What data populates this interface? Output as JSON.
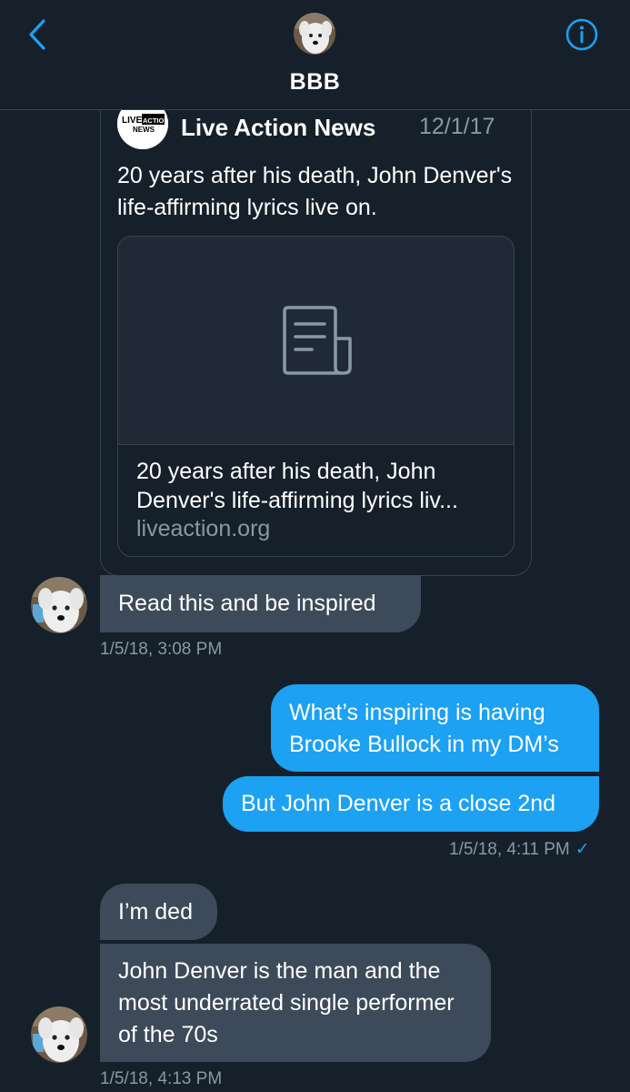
{
  "header": {
    "title": "BBB"
  },
  "shared_tweet": {
    "logo_text_top": "LIVE",
    "logo_text_mid": "ACTION",
    "logo_text_bottom": "NEWS",
    "author": "Live Action News",
    "date": "12/1/17",
    "text": "20 years after his death, John Denver's life-affirming lyrics live on.",
    "link_card": {
      "title": "20 years after his death, John Denver's life-affirming lyrics liv...",
      "domain": "liveaction.org"
    }
  },
  "messages": [
    {
      "id": "m1",
      "direction": "received",
      "text": "Read this and be inspired"
    },
    {
      "id": "m2",
      "direction": "sent",
      "text": "What’s inspiring is having Brooke Bullock in my DM’s"
    },
    {
      "id": "m3",
      "direction": "sent",
      "text": "But John Denver is a close 2nd"
    },
    {
      "id": "m4",
      "direction": "received",
      "text": "I’m ded"
    },
    {
      "id": "m5",
      "direction": "received",
      "text": "John Denver is the man and the most underrated single performer of the 70s"
    }
  ],
  "timestamps": {
    "t1": "1/5/18, 3:08 PM",
    "t2": "1/5/18, 4:11 PM",
    "t2_check": "✓",
    "t3": "1/5/18, 4:13 PM"
  },
  "colors": {
    "background": "#15202b",
    "accent": "#1da1f2",
    "received_bubble": "#3d4a59",
    "secondary_text": "#8899a6"
  },
  "icons": {
    "back": "chevron-left-icon",
    "info": "info-circle-icon",
    "article": "article-icon"
  }
}
